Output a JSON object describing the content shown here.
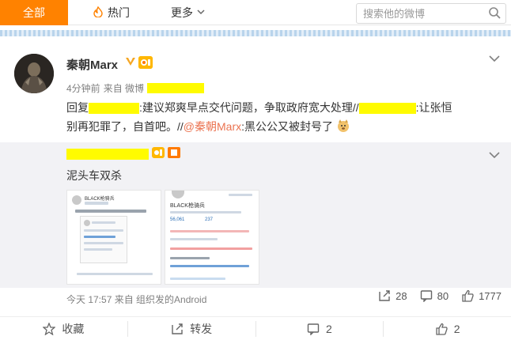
{
  "tabs": {
    "all": "全部",
    "hot": "热门",
    "more": "更多"
  },
  "search": {
    "placeholder": "搜索他的微博"
  },
  "post": {
    "username": "秦朝Marx",
    "meta_time": "4分钟前",
    "meta_from": "来自 微博",
    "content_reply_prefix": "回复",
    "content_text_1": ":建议郑爽早点交代问题，争取政府宽大处理//",
    "content_text_2": ":让张恒",
    "content_text_3": "别再犯罪了，自首吧。//",
    "content_at": "@秦朝Marx",
    "content_text_4": ":黑公公又被封号了"
  },
  "repost": {
    "text": "泥头车双杀",
    "footer": "今天 17:57 来自 组织发的Android",
    "reposts": "28",
    "comments": "80",
    "likes": "1777",
    "thumb1_title": "BLACK枪骑兵",
    "thumb2_title": "BLACK枪骑兵",
    "thumb2_stat1": "56,061",
    "thumb2_stat2": "237"
  },
  "actions": {
    "favorite": "收藏",
    "forward": "转发",
    "comment": "2",
    "like": "2"
  },
  "colors": {
    "accent": "#ff8200",
    "link": "#eb7350",
    "highlight": "#fffb00"
  }
}
